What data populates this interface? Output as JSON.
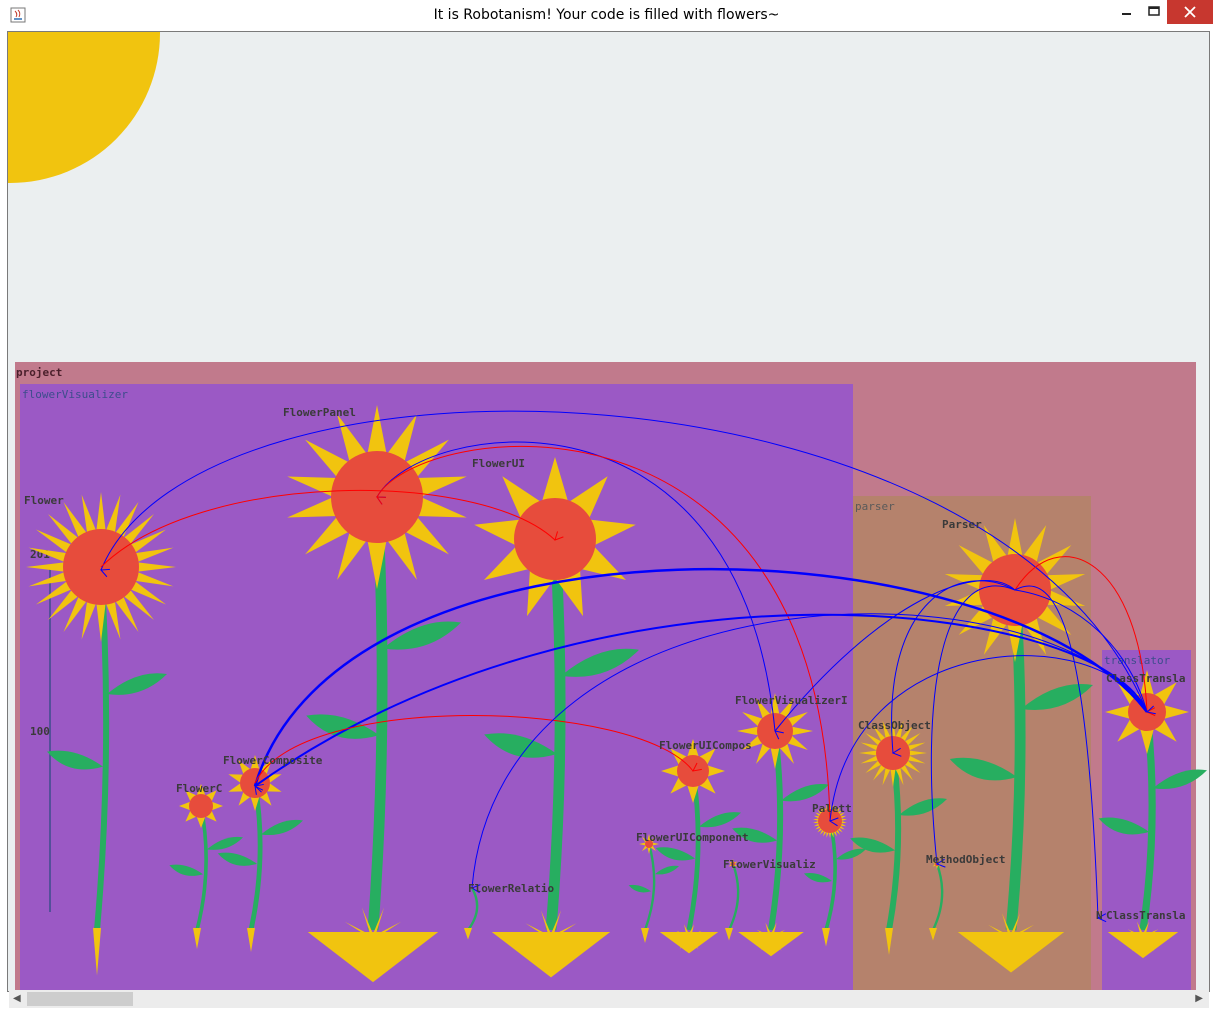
{
  "window": {
    "title": "It is Robotanism! Your code is filled with flowers~"
  },
  "packages": {
    "project": "project",
    "flowerVisualizer": "flowerVisualizer",
    "parser": "parser",
    "translator": "translator"
  },
  "classes": {
    "flower": "Flower",
    "flower_panel": "FlowerPanel",
    "flower_ui": "FlowerUI",
    "parser": "Parser",
    "class_translator": "ClassTransla",
    "flower_visualizer": "FlowerVisualizerI",
    "class_object": "ClassObject",
    "flower_ui_compos": "FlowerUICompos",
    "flower_composite": "FlowerComposite",
    "flower_c": "FlowerC",
    "palette": "Palett",
    "flower_ui_component": "FlowerUIComponent",
    "flower_visualiz": "FlowerVisualiz",
    "method_object": "MethodObject",
    "flower_relation": "FlowerRelatio",
    "class_transla_bottom": "ClassTransla",
    "n_label": "N"
  },
  "scale": {
    "top": "201",
    "mid": "100"
  },
  "colors": {
    "sky": "#ebeff0",
    "sun": "#f1c40f",
    "project": "#c17a8c",
    "flowerVisualizer": "#9b59c5",
    "parser": "#b5826c",
    "translator": "#9b59c5",
    "petal": "#f1c40f",
    "center": "#e74c3c",
    "stem": "#27ae60",
    "dependency": "#0000ff",
    "inheritance": "#ff0000"
  },
  "icons": {
    "app": "java-app-icon",
    "minimize": "minimize-icon",
    "maximize": "maximize-icon",
    "close": "close-icon",
    "scroll_left": "scroll-left-icon",
    "scroll_right": "scroll-right-icon"
  }
}
